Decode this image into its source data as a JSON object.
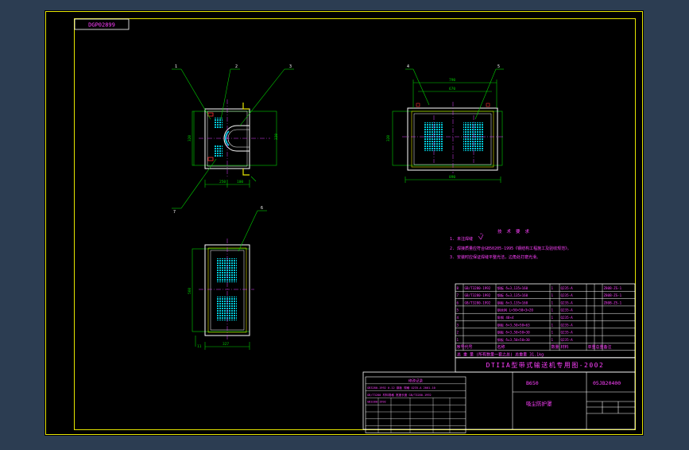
{
  "drawing": {
    "code_box": "DGP02899",
    "views": {
      "top_left": {
        "callouts": [
          "1",
          "2",
          "3",
          "7"
        ]
      },
      "top_right": {
        "callouts": [
          "4",
          "5"
        ]
      },
      "bottom": {
        "callouts": [
          "6"
        ]
      }
    },
    "notes": {
      "title": "技术要求",
      "items": [
        "1. 未注焊缝",
        "2. 焊接质量应符合GB50205-1995《钢结构工程施工及验收规范》。",
        "3. 安装时应保证焊缝平整光洁，边角处打磨光滑。"
      ]
    },
    "title_block": {
      "headline": "DTIIA型带式输送机专用图-2002",
      "model": "B650",
      "drawing_no": "05JB20400",
      "drawing_name": "吸尘防护罩",
      "weight": "31.1kg",
      "header_row": [
        "序号",
        "代号",
        "名称",
        "数量",
        "材料",
        "单重",
        "总重",
        "备注"
      ],
      "parts": [
        [
          "8",
          "GB/T3280-1992",
          "钢板 δ=3,135×160",
          "1",
          "Q235-A",
          "",
          "",
          "Z80B-ZS-1"
        ],
        [
          "7",
          "GB/T3280-1992",
          "钢板 δ=3,135×160",
          "1",
          "Q235-A",
          "",
          "",
          "Z80B-ZS-1"
        ],
        [
          "6",
          "GB/T3280-1992",
          "钢板 δ=3,135×160",
          "1",
          "Q235-A",
          "",
          "",
          "Z80B-ZS-1"
        ],
        [
          "5",
          "",
          "钢丝网 L=50×50×3×20",
          "1",
          "Q235-A",
          "",
          "",
          ""
        ],
        [
          "4",
          "",
          "角钢 40×4",
          "1",
          "Q235-A",
          "",
          "",
          ""
        ],
        [
          "3",
          "",
          "钢板 δ=3,50×50×63",
          "1",
          "Q235-A",
          "",
          "",
          ""
        ],
        [
          "2",
          "",
          "钢板 δ=3,50×50×30",
          "1",
          "Q235-A",
          "",
          "",
          ""
        ],
        [
          "1",
          "",
          "钢板 δ=3,50×50×30",
          "1",
          "Q235-A",
          "",
          "",
          ""
        ]
      ],
      "summary_row": "总 重 量 (所有数量一套之总) 总重量 31.1kg"
    },
    "revision_table": {
      "title": "修改记录",
      "rows": [
        "GB3280-1992 0.12 钢板 规格 Q235-A 2001-10",
        "GB/T3280 材料规格 宽度长度 GB/T3280-1992",
        "GB3280-1992",
        "",
        "",
        "",
        ""
      ]
    },
    "colors": {
      "sheet": "#000000",
      "frame": "#e6e600",
      "outline": "#ffffff",
      "dims": "#00d000",
      "text": "#ff40ff",
      "hatch": "#00c8d8",
      "center": "#e040ff",
      "accent": "#ff3030"
    }
  }
}
